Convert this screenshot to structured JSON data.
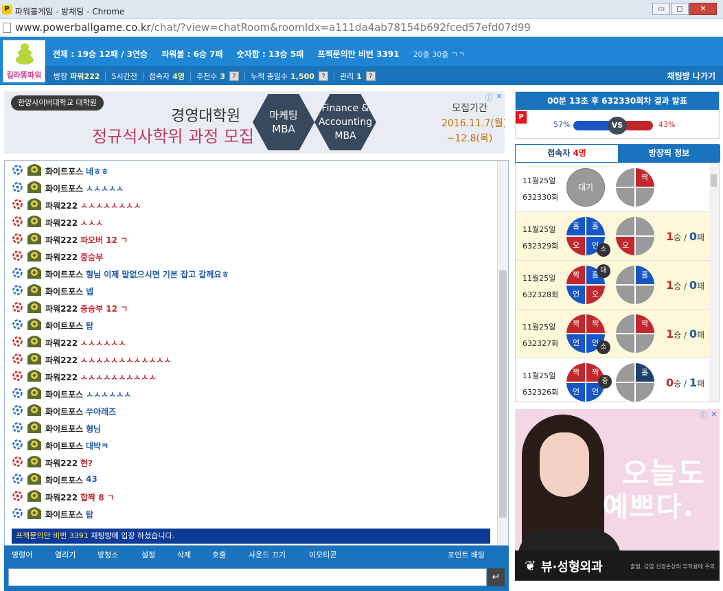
{
  "window": {
    "title": "파워볼게임 - 방채팅 - Chrome",
    "icon": "P",
    "buttons": [
      "▭",
      "◻",
      "✕"
    ]
  },
  "url": {
    "host": "www.powerballgame.co.kr",
    "path": "/chat/?view=chatRoom&roomIdx=a111da4ab78154b692fced57efd07d99"
  },
  "header": {
    "logo_text": "킬라똥파워",
    "stats": [
      {
        "label": "전체 : 19승 12패 / 3연승"
      },
      {
        "label": "파워볼 : 6승 7패"
      },
      {
        "label": "숫자합 : 13승 5패"
      },
      {
        "label": "프젝문의만 비번 3391"
      }
    ],
    "stats_small": "20출 30출 ㄱㄱ",
    "info": {
      "host_label": "방장",
      "host_value": "파워222",
      "time": "5시간전",
      "users_label": "접속자",
      "users_value": "4명",
      "recommend_label": "추천수",
      "recommend_value": "3",
      "total_label": "누적 충일수",
      "total_value": "1,500",
      "admin_label": "관리",
      "admin_value": "1",
      "help": "?"
    },
    "leave_label": "채팅방 나가기"
  },
  "ad_top": {
    "school": "한양사이버대학교 대학원",
    "line1": "경영대학원",
    "line2": "정규석사학위 과정 모집",
    "hex1": "마케팅\nMBA",
    "hex2": "Finance &\nAccounting\nMBA",
    "period_title": "모집기간",
    "period_start": "2016.11.7(월)",
    "period_end": "~12.8(목)"
  },
  "chat": {
    "messages": [
      {
        "user": "화이트포스",
        "text": "네ㅎㅎ",
        "type": "user1"
      },
      {
        "user": "화이트포스",
        "text": "ㅅㅅㅅㅅㅅ",
        "type": "user1"
      },
      {
        "user": "파워222",
        "text": "ㅅㅅㅅㅅㅅㅅㅅㅅ",
        "type": "user2"
      },
      {
        "user": "파워222",
        "text": "ㅅㅅㅅ",
        "type": "user2"
      },
      {
        "user": "파워222",
        "text": "파오버 12 ㄱ",
        "type": "user2"
      },
      {
        "user": "파워222",
        "text": "중승부",
        "type": "user2"
      },
      {
        "user": "화이트포스",
        "text": "형님 이제 말없으시면 기본 잡고 갈께요ㅎ",
        "type": "user1"
      },
      {
        "user": "화이트포스",
        "text": "넵",
        "type": "user1"
      },
      {
        "user": "파워222",
        "text": "중승부 12 ㄱ",
        "type": "user2"
      },
      {
        "user": "화이트포스",
        "text": "탑",
        "type": "user1"
      },
      {
        "user": "파워222",
        "text": "ㅅㅅㅅㅅㅅㅅ",
        "type": "user2"
      },
      {
        "user": "파워222",
        "text": "ㅅㅅㅅㅅㅅㅅㅅㅅㅅㅅㅅㅅ",
        "type": "user2"
      },
      {
        "user": "파워222",
        "text": "ㅅㅅㅅㅅㅅㅅㅅㅅㅅㅅ",
        "type": "user2"
      },
      {
        "user": "화이트포스",
        "text": "ㅅㅅㅅㅅㅅㅅ",
        "type": "user1"
      },
      {
        "user": "화이트포스",
        "text": "쑤아레즈",
        "type": "user1"
      },
      {
        "user": "화이트포스",
        "text": "형님",
        "type": "user1"
      },
      {
        "user": "화이트포스",
        "text": "대박ㅋ",
        "type": "user1"
      },
      {
        "user": "파워222",
        "text": "현?",
        "type": "user2"
      },
      {
        "user": "화이트포스",
        "text": "43",
        "type": "user1"
      },
      {
        "user": "파워222",
        "text": "합짝 8 ㄱ",
        "type": "user2"
      },
      {
        "user": "화이트포스",
        "text": "탑",
        "type": "user1"
      }
    ],
    "system_user": "프젝문의만 비번 3391",
    "system_text": " 채팅방에 입장 하셨습니다."
  },
  "toolbar": {
    "items": [
      "명령어",
      "열리기",
      "방청소",
      "설정",
      "삭제",
      "호출",
      "사운드 끄기",
      "이모티콘"
    ],
    "point": "포인트 배팅"
  },
  "input": {
    "placeholder": "",
    "send": "↵"
  },
  "announce": {
    "title_a": "00분 13초 후",
    "title_b": "632330회차",
    "title_c": "결과 발표",
    "blue_pct": "57%",
    "red_pct": "43%",
    "vs": "VS",
    "power_badge": "P",
    "colors": {
      "blue": "#1756c4",
      "red": "#c0282d"
    }
  },
  "tabs": {
    "users_label": "접속자",
    "users_count": "4명",
    "host_pick": "방장픽 정보"
  },
  "history": [
    {
      "date": "11월25일",
      "round": "632330회",
      "wait": "대기",
      "pick": [
        "",
        "짝",
        "",
        ""
      ],
      "pick_colors": [
        "g",
        "r",
        "g",
        "g"
      ],
      "record": null,
      "hl": false
    },
    {
      "date": "11월25일",
      "round": "632329회",
      "result": [
        "홀",
        "홀",
        "오",
        "언"
      ],
      "result_colors": [
        "b",
        "b",
        "r",
        "b"
      ],
      "badge": "소",
      "badge_pos": "br",
      "pick": [
        "",
        "",
        "오",
        ""
      ],
      "pick_colors": [
        "g",
        "g",
        "r",
        "g"
      ],
      "wins": "1",
      "win_label": "승",
      "slash": "/",
      "losses": "0",
      "loss_label": "패",
      "hl": true
    },
    {
      "date": "11월25일",
      "round": "632328회",
      "result": [
        "짝",
        "홀",
        "언",
        "오"
      ],
      "result_colors": [
        "r",
        "b",
        "b",
        "r"
      ],
      "badge": "대",
      "badge_pos": "tr",
      "pick": [
        "",
        "홀",
        "",
        ""
      ],
      "pick_colors": [
        "g",
        "b",
        "g",
        "g"
      ],
      "wins": "1",
      "win_label": "승",
      "slash": "/",
      "losses": "0",
      "loss_label": "패",
      "hl": true
    },
    {
      "date": "11월25일",
      "round": "632327회",
      "result": [
        "짝",
        "짝",
        "언",
        "언"
      ],
      "result_colors": [
        "r",
        "r",
        "b",
        "b"
      ],
      "badge": "소",
      "badge_pos": "br",
      "pick": [
        "",
        "짝",
        "",
        ""
      ],
      "pick_colors": [
        "g",
        "r",
        "g",
        "g"
      ],
      "wins": "1",
      "win_label": "승",
      "slash": "/",
      "losses": "0",
      "loss_label": "패",
      "hl": true
    },
    {
      "date": "11월25일",
      "round": "632326회",
      "result": [
        "짝",
        "짝",
        "언",
        "언"
      ],
      "result_colors": [
        "r",
        "r",
        "b",
        "b"
      ],
      "badge": "중",
      "badge_pos": "r",
      "pick": [
        "",
        "홀",
        "",
        ""
      ],
      "pick_colors": [
        "g",
        "n",
        "g",
        "g"
      ],
      "wins": "0",
      "win_label": "승",
      "slash": "/",
      "losses": "1",
      "loss_label": "패",
      "hl": false
    }
  ],
  "ad_side": {
    "line1": "오늘도",
    "line2": "예쁘다.",
    "brand": "뷰·성형외과",
    "notice": "출혈, 감염 신경손상의 부작용에 주의"
  }
}
